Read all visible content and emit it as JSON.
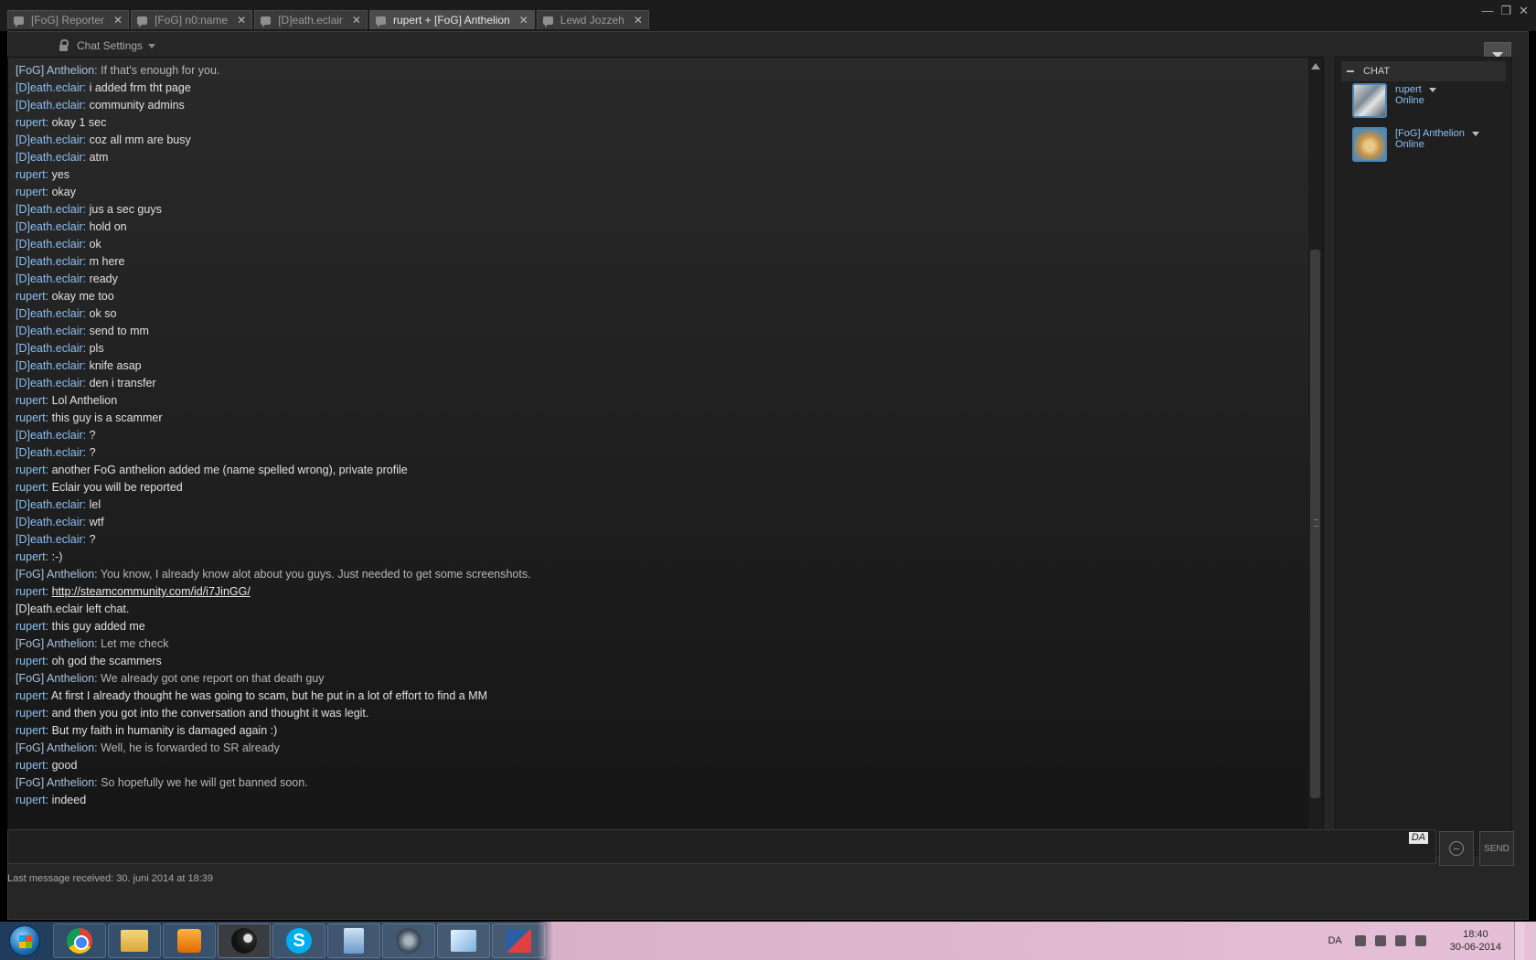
{
  "tabs": [
    {
      "label": "[FoG] Reporter",
      "active": false
    },
    {
      "label": "[FoG] n0:name",
      "active": false
    },
    {
      "label": "[D]eath.eclair",
      "active": false
    },
    {
      "label": "rupert + [FoG] Anthelion",
      "active": true
    },
    {
      "label": "Lewd Jozzeh",
      "active": false
    }
  ],
  "window_controls": {
    "minimize": "—",
    "restore": "❐",
    "close": "✕"
  },
  "toolbar": {
    "chat_settings": "Chat Settings"
  },
  "messages": [
    {
      "name": "[FoG] Anthelion",
      "text": "If that's enough for you.",
      "fog": true
    },
    {
      "name": "[D]eath.eclair",
      "text": "i added frm tht page"
    },
    {
      "name": "[D]eath.eclair",
      "text": "community admins"
    },
    {
      "name": "rupert",
      "text": "okay 1 sec"
    },
    {
      "name": "[D]eath.eclair",
      "text": "coz all mm are busy"
    },
    {
      "name": "[D]eath.eclair",
      "text": "atm"
    },
    {
      "name": "rupert",
      "text": "yes"
    },
    {
      "name": "rupert",
      "text": "okay"
    },
    {
      "name": "[D]eath.eclair",
      "text": "jus a sec guys"
    },
    {
      "name": "[D]eath.eclair",
      "text": "hold on"
    },
    {
      "name": "[D]eath.eclair",
      "text": "ok"
    },
    {
      "name": "[D]eath.eclair",
      "text": "m here"
    },
    {
      "name": "[D]eath.eclair",
      "text": "ready"
    },
    {
      "name": "rupert",
      "text": "okay me too"
    },
    {
      "name": "[D]eath.eclair",
      "text": "ok so"
    },
    {
      "name": "[D]eath.eclair",
      "text": "send to mm"
    },
    {
      "name": "[D]eath.eclair",
      "text": "pls"
    },
    {
      "name": "[D]eath.eclair",
      "text": "knife asap"
    },
    {
      "name": "[D]eath.eclair",
      "text": "den i transfer"
    },
    {
      "name": "rupert",
      "text": "Lol Anthelion"
    },
    {
      "name": "rupert",
      "text": "this guy is a scammer"
    },
    {
      "name": "[D]eath.eclair",
      "text": "?"
    },
    {
      "name": "[D]eath.eclair",
      "text": "?"
    },
    {
      "name": "rupert",
      "text": "another FoG anthelion added me (name spelled wrong), private profile"
    },
    {
      "name": "rupert",
      "text": "Eclair you will be reported"
    },
    {
      "name": "[D]eath.eclair",
      "text": "lel"
    },
    {
      "name": "[D]eath.eclair",
      "text": "wtf"
    },
    {
      "name": "[D]eath.eclair",
      "text": "?"
    },
    {
      "name": "rupert",
      "text": ":-)"
    },
    {
      "name": "[FoG] Anthelion",
      "text": "You know, I already know alot about you guys. Just needed to get some screenshots.",
      "fog": true
    },
    {
      "name": "rupert",
      "text": "http://steamcommunity.com/id/i7JinGG/",
      "link": true
    },
    {
      "system": true,
      "text": "[D]eath.eclair left chat."
    },
    {
      "name": "rupert",
      "text": "this guy added me"
    },
    {
      "name": "[FoG] Anthelion",
      "text": "Let me check",
      "fog": true
    },
    {
      "name": "rupert",
      "text": "oh god the scammers"
    },
    {
      "name": "[FoG] Anthelion",
      "text": "We already got one report on that death guy",
      "fog": true
    },
    {
      "name": "rupert",
      "text": "At first I already thought he was going to scam, but he put in a lot of effort to find a MM"
    },
    {
      "name": "rupert",
      "text": "and then you got into the conversation and thought it was legit."
    },
    {
      "name": "rupert",
      "text": "But my faith in humanity is damaged again :)"
    },
    {
      "name": "[FoG] Anthelion",
      "text": "Well, he is forwarded to SR already",
      "fog": true
    },
    {
      "name": "rupert",
      "text": "good"
    },
    {
      "name": "[FoG] Anthelion",
      "text": "So hopefully we he will get banned soon.",
      "fog": true
    },
    {
      "name": "rupert",
      "text": "indeed"
    }
  ],
  "members_panel": {
    "header": "CHAT",
    "members": [
      {
        "name": "rupert",
        "status": "Online"
      },
      {
        "name": "[FoG] Anthelion",
        "status": "Online"
      }
    ]
  },
  "input": {
    "value": "",
    "language": "DA"
  },
  "buttons": {
    "send": "SEND"
  },
  "status_bar": {
    "last_message": "Last message received: 30. juni 2014 at 18:39"
  },
  "taskbar": {
    "apps": [
      "windows-start-icon",
      "chrome-icon",
      "file-explorer-icon",
      "media-player-icon",
      "steam-icon",
      "skype-icon",
      "calculator-icon",
      "teamspeak-icon",
      "notepad-icon",
      "snipping-tool-icon"
    ],
    "skype_glyph": "S",
    "language": "DA",
    "time": "18:40",
    "date": "30-06-2014"
  }
}
